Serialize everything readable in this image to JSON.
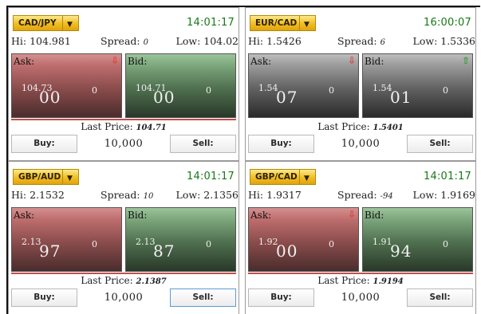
{
  "widgets": [
    {
      "pair": "CAD/JPY",
      "time": "14:01:17",
      "hi": "Hi: 104.981",
      "spread_label": "Spread:",
      "spread": "0",
      "low": "Low: 104.02",
      "ask": {
        "label": "Ask:",
        "big": "104.73",
        "pips": "00",
        "frac": "0",
        "trend": "down",
        "color": "red"
      },
      "bid": {
        "label": "Bid:",
        "big": "104.71",
        "pips": "00",
        "frac": "0",
        "trend": "",
        "color": "green"
      },
      "last_label": "Last Price:",
      "last": "104.71",
      "buy": "Buy:",
      "amount": "10,000",
      "sell": "Sell:",
      "sell_focused": false,
      "line": "r"
    },
    {
      "pair": "EUR/CAD",
      "time": "16:00:07",
      "hi": "Hi: 1.5426",
      "spread_label": "Spread:",
      "spread": "6",
      "low": "Low: 1.5336",
      "ask": {
        "label": "Ask:",
        "big": "1.54",
        "pips": "07",
        "frac": "0",
        "trend": "down",
        "color": "grey"
      },
      "bid": {
        "label": "Bid:",
        "big": "1.54",
        "pips": "01",
        "frac": "0",
        "trend": "up",
        "color": "grey"
      },
      "last_label": "Last Price:",
      "last": "1.5401",
      "buy": "Buy:",
      "amount": "10,000",
      "sell": "Sell:",
      "sell_focused": false,
      "line": "n"
    },
    {
      "pair": "GBP/AUD",
      "time": "14:01:17",
      "hi": "Hi: 2.1532",
      "spread_label": "Spread:",
      "spread": "10",
      "low": "Low: 2.1356",
      "ask": {
        "label": "Ask:",
        "big": "2.13",
        "pips": "97",
        "frac": "0",
        "trend": "",
        "color": "red"
      },
      "bid": {
        "label": "Bid:",
        "big": "2.13",
        "pips": "87",
        "frac": "0",
        "trend": "",
        "color": "green"
      },
      "last_label": "Last Price:",
      "last": "2.1387",
      "buy": "Buy:",
      "amount": "10,000",
      "sell": "Sell:",
      "sell_focused": true,
      "line": "r"
    },
    {
      "pair": "GBP/CAD",
      "time": "14:01:17",
      "hi": "Hi: 1.9317",
      "spread_label": "Spread:",
      "spread": "-94",
      "low": "Low: 1.9169",
      "ask": {
        "label": "Ask:",
        "big": "1.92",
        "pips": "00",
        "frac": "0",
        "trend": "down",
        "color": "red"
      },
      "bid": {
        "label": "Bid:",
        "big": "1.91",
        "pips": "94",
        "frac": "0",
        "trend": "",
        "color": "green"
      },
      "last_label": "Last Price:",
      "last": "1.9194",
      "buy": "Buy:",
      "amount": "10,000",
      "sell": "Sell:",
      "sell_focused": false,
      "line": "r"
    }
  ]
}
